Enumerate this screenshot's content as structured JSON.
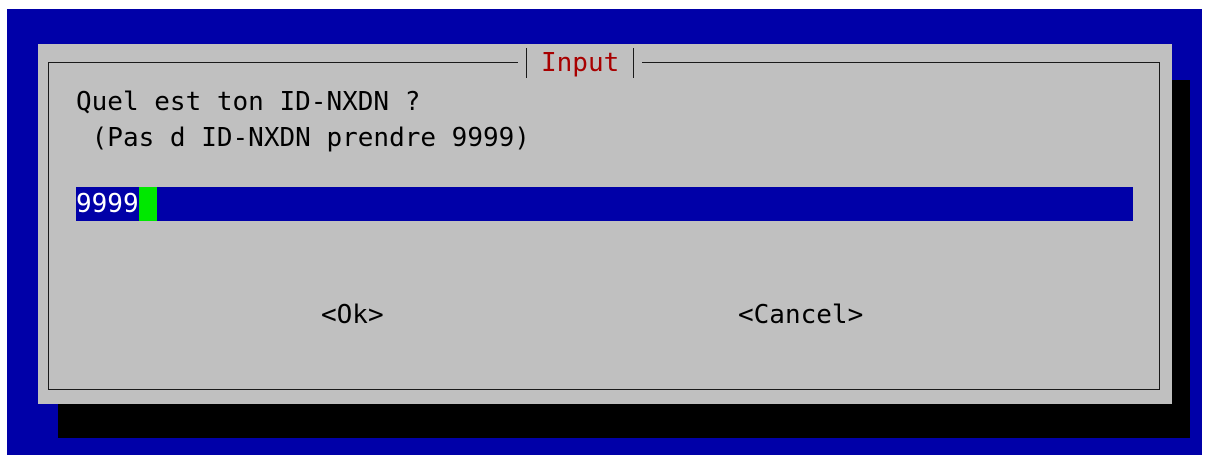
{
  "dialog": {
    "title": "Input",
    "prompt_line1": "Quel est ton ID-NXDN ?",
    "prompt_line2": " (Pas d ID-NXDN prendre 9999)",
    "input_value": "9999",
    "ok_label": "<Ok>",
    "cancel_label": "<Cancel>"
  },
  "colors": {
    "background": "#0000a8",
    "dialog": "#c0c0c0",
    "title": "#a80000",
    "input_bg": "#0000a8",
    "cursor": "#00e800"
  }
}
